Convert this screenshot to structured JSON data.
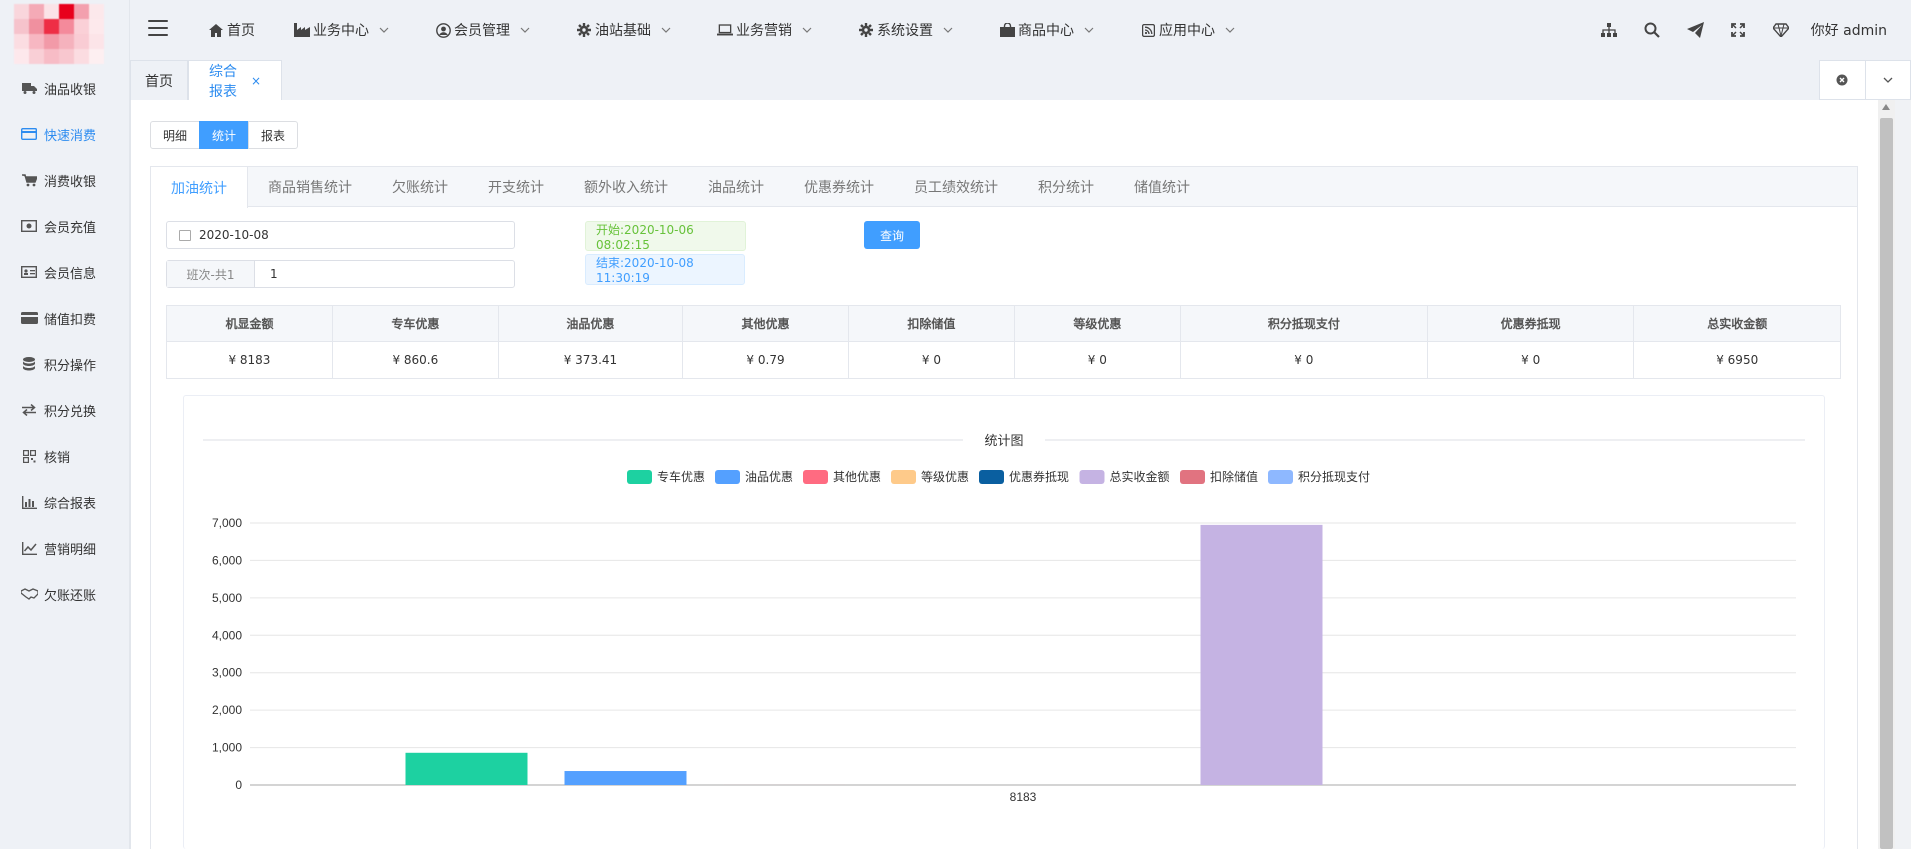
{
  "sidebar": {
    "items": [
      {
        "label": "油品收银",
        "icon": "truck-icon"
      },
      {
        "label": "快速消费",
        "icon": "credit-card-icon",
        "active": true
      },
      {
        "label": "消费收银",
        "icon": "cart-icon"
      },
      {
        "label": "会员充值",
        "icon": "money-icon"
      },
      {
        "label": "会员信息",
        "icon": "id-card-icon"
      },
      {
        "label": "储值扣费",
        "icon": "card-icon"
      },
      {
        "label": "积分操作",
        "icon": "database-icon"
      },
      {
        "label": "积分兑换",
        "icon": "exchange-icon"
      },
      {
        "label": "核销",
        "icon": "qrcode-icon"
      },
      {
        "label": "综合报表",
        "icon": "bar-chart-icon"
      },
      {
        "label": "营销明细",
        "icon": "line-chart-icon"
      },
      {
        "label": "欠账还账",
        "icon": "handshake-icon"
      }
    ]
  },
  "topnav": {
    "menu": [
      {
        "label": "首页",
        "icon": "home-icon",
        "dropdown": false
      },
      {
        "label": "业务中心",
        "icon": "industry-icon",
        "dropdown": true
      },
      {
        "label": "会员管理",
        "icon": "user-circle-icon",
        "dropdown": true
      },
      {
        "label": "油站基础",
        "icon": "gear-icon",
        "dropdown": true
      },
      {
        "label": "业务营销",
        "icon": "laptop-icon",
        "dropdown": true
      },
      {
        "label": "系统设置",
        "icon": "gear-icon",
        "dropdown": true
      },
      {
        "label": "商品中心",
        "icon": "shopping-bag-icon",
        "dropdown": true
      },
      {
        "label": "应用中心",
        "icon": "rss-icon",
        "dropdown": true
      }
    ],
    "greeting": "你好 admin"
  },
  "page_tabs": [
    {
      "label": "首页"
    },
    {
      "label": "综合报表",
      "closable": "×",
      "active": true
    }
  ],
  "segments": [
    "明细",
    "统计",
    "报表"
  ],
  "active_segment": "统计",
  "subtabs": [
    "加油统计",
    "商品销售统计",
    "欠账统计",
    "开支统计",
    "额外收入统计",
    "油品统计",
    "优惠券统计",
    "员工绩效统计",
    "积分统计",
    "储值统计"
  ],
  "filters": {
    "date": "2020-10-08",
    "shift_label": "班次-共1",
    "shift_value": "1",
    "start_tag": "开始:2020-10-06 08:02:15",
    "end_tag": "结束:2020-10-08 11:30:19",
    "query_label": "查询"
  },
  "summary": {
    "headers": [
      "机显金额",
      "专车优惠",
      "油品优惠",
      "其他优惠",
      "扣除储值",
      "等级优惠",
      "积分抵现支付",
      "优惠券抵现",
      "总实收金额"
    ],
    "values": [
      "¥ 8183",
      "¥ 860.6",
      "¥ 373.41",
      "¥ 0.79",
      "¥ 0",
      "¥ 0",
      "¥ 0",
      "¥ 0",
      "¥ 6950"
    ]
  },
  "chart_data": {
    "type": "bar",
    "title": "统计图",
    "categories": [
      "8183"
    ],
    "series": [
      {
        "name": "专车优惠",
        "values": [
          860.6
        ],
        "color": "#1dd1a1"
      },
      {
        "name": "油品优惠",
        "values": [
          373.41
        ],
        "color": "#54a0ff"
      },
      {
        "name": "其他优惠",
        "values": [
          0.79
        ],
        "color": "#ff6b81"
      },
      {
        "name": "等级优惠",
        "values": [
          0
        ],
        "color": "#feca8a"
      },
      {
        "name": "优惠券抵现",
        "values": [
          0
        ],
        "color": "#0a5fa0"
      },
      {
        "name": "总实收金额",
        "values": [
          6950
        ],
        "color": "#c5b3e3"
      },
      {
        "name": "扣除储值",
        "values": [
          0
        ],
        "color": "#e17380"
      },
      {
        "name": "积分抵现支付",
        "values": [
          0
        ],
        "color": "#8eb8ff"
      }
    ],
    "ylim": [
      0,
      7000
    ],
    "yticks": [
      "0",
      "1,000",
      "2,000",
      "3,000",
      "4,000",
      "5,000",
      "6,000",
      "7,000"
    ],
    "grid": true,
    "legend": "top-center"
  }
}
